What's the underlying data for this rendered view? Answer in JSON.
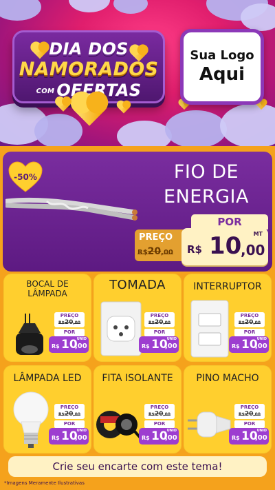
{
  "hero": {
    "title_line1": "DIA DOS",
    "title_line2": "NAMORADOS",
    "title_com": "COM",
    "title_line3": "OFERTAS",
    "logo_line1": "Sua Logo",
    "logo_line2": "Aqui"
  },
  "featured": {
    "discount": "-50%",
    "name_line1": "FIO DE",
    "name_line2": "ENERGIA",
    "por_label": "POR",
    "preco_label": "PREÇO",
    "old_currency": "R$",
    "old_int": "20",
    "old_dec": ",00",
    "new_currency": "R$",
    "new_int": "10",
    "new_dec": ",00",
    "unit": "MT"
  },
  "products": [
    {
      "name_line1": "BOCAL DE",
      "name_line2": "LÂMPADA",
      "preco_label": "PREÇO",
      "old_int": "20",
      "old_dec": ",00",
      "por_label": "POR",
      "cur": "R$",
      "new_int": "10",
      "new_dec": ",00",
      "unit": "UNID"
    },
    {
      "name_line1": "TOMADA",
      "preco_label": "PREÇO",
      "old_int": "20",
      "old_dec": ",00",
      "por_label": "POR",
      "cur": "R$",
      "new_int": "10",
      "new_dec": ",00",
      "unit": "UNID"
    },
    {
      "name_line1": "INTERRUPTOR",
      "preco_label": "PREÇO",
      "old_int": "20",
      "old_dec": ",00",
      "por_label": "POR",
      "cur": "R$",
      "new_int": "10",
      "new_dec": ",00",
      "unit": "UNID"
    },
    {
      "name_line1": "LÂMPADA LED",
      "preco_label": "PREÇO",
      "old_int": "20",
      "old_dec": ",00",
      "por_label": "POR",
      "cur": "R$",
      "new_int": "10",
      "new_dec": ",00",
      "unit": "UNID"
    },
    {
      "name_line1": "FITA ISOLANTE",
      "preco_label": "PREÇO",
      "old_int": "20",
      "old_dec": ",00",
      "por_label": "POR",
      "cur": "R$",
      "new_int": "10",
      "new_dec": ",00",
      "unit": "UNID"
    },
    {
      "name_line1": "PINO MACHO",
      "preco_label": "PREÇO",
      "old_int": "20",
      "old_dec": ",00",
      "por_label": "POR",
      "cur": "R$",
      "new_int": "10",
      "new_dec": ",00",
      "unit": "UNID"
    }
  ],
  "cta": {
    "label": "Crie seu encarte com este tema!"
  },
  "footnote": "*Imagens Meramente Ilustrativas",
  "colors": {
    "purple": "#7a2d9f",
    "yellow": "#ffcf2e",
    "orange": "#f5a21c",
    "pink": "#e01e6d"
  }
}
